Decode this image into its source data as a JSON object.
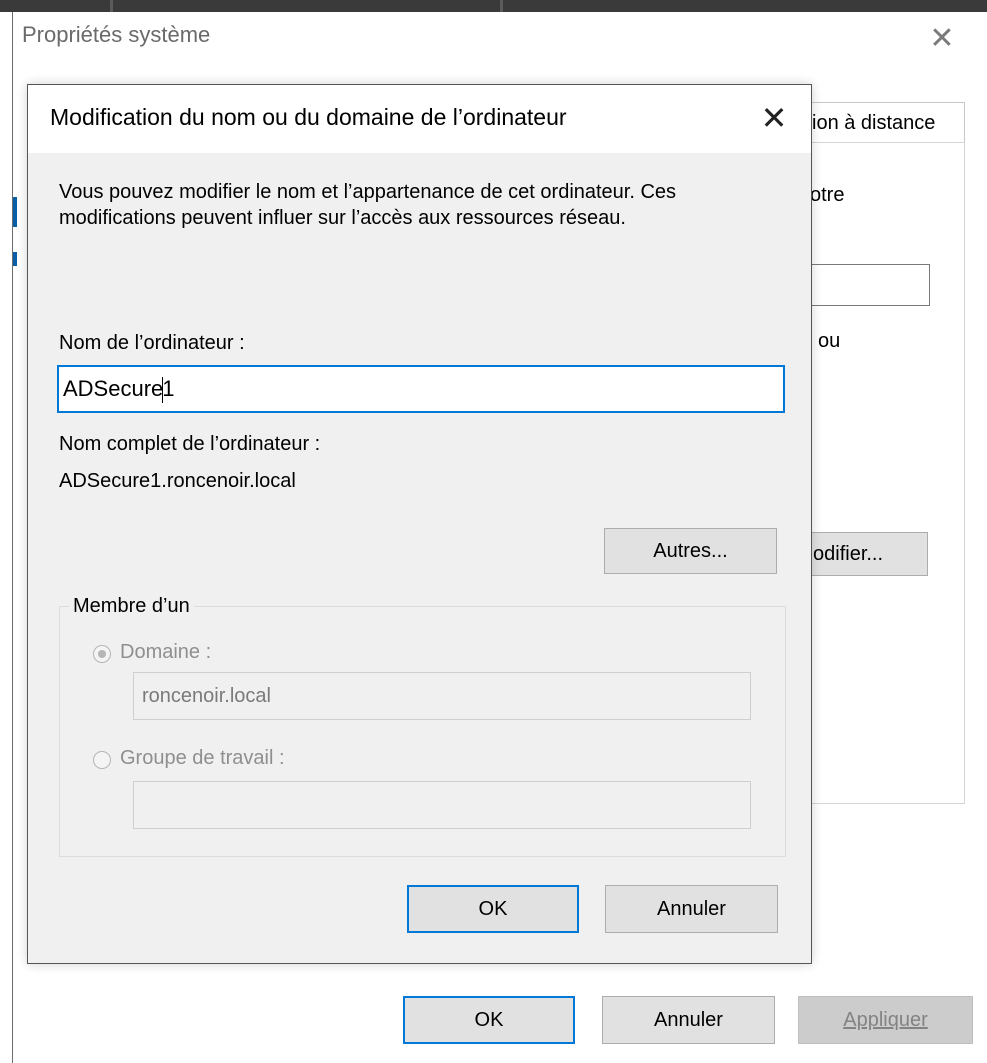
{
  "parent_window": {
    "title": "Propriétés système",
    "close_glyph": "✕",
    "tab_label_partial": "ion à distance",
    "peek_text_1": "otre",
    "peek_text_2": "ou",
    "modify_button_partial": "odifier...",
    "buttons": {
      "ok": "OK",
      "cancel": "Annuler",
      "apply": "Appliquer"
    }
  },
  "dialog": {
    "title": "Modification du nom ou du domaine de l’ordinateur",
    "close_glyph": "✕",
    "description": "Vous pouvez modifier le nom et l’appartenance de cet ordinateur. Ces modifications peuvent influer sur l’accès aux ressources réseau.",
    "computer_name_label": "Nom de l’ordinateur :",
    "computer_name_value_before_caret": "ADSecure",
    "computer_name_value_after_caret": "1",
    "full_name_label": "Nom complet de l’ordinateur :",
    "full_name_value": "ADSecure1.roncenoir.local",
    "more_button": "Autres...",
    "member_of": {
      "legend": "Membre d’un",
      "domain_label": "Domaine :",
      "domain_value": "roncenoir.local",
      "domain_selected": true,
      "workgroup_label": "Groupe de travail :",
      "workgroup_value": ""
    },
    "buttons": {
      "ok": "OK",
      "cancel": "Annuler"
    }
  }
}
